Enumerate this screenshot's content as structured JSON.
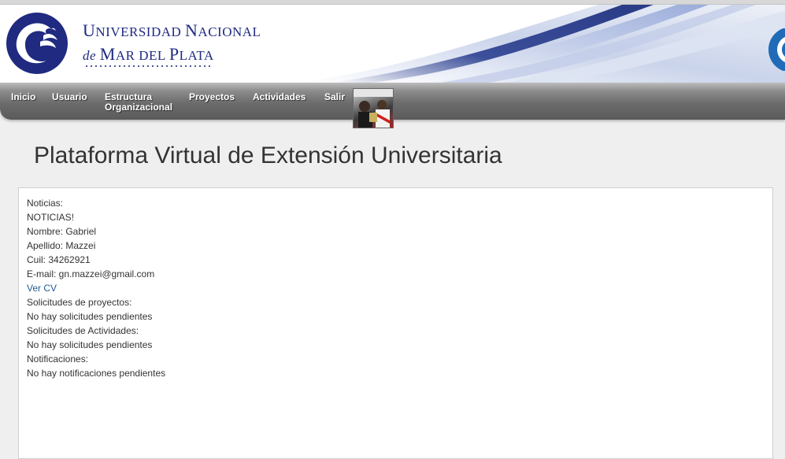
{
  "university": {
    "line1_initial": "U",
    "line1_rest": "NIVERSIDAD ",
    "line1b_initial": "N",
    "line1b_rest": "ACIONAL",
    "line2_prefix": "de",
    "line2_initial1": "M",
    "line2_rest1": "AR DEL ",
    "line2_initial2": "P",
    "line2_rest2": "LATA"
  },
  "nav": {
    "items": [
      {
        "label": "Inicio"
      },
      {
        "label": "Usuario"
      },
      {
        "label": "Estructura\nOrganizacional"
      },
      {
        "label": "Proyectos"
      },
      {
        "label": "Actividades"
      },
      {
        "label": "Salir"
      }
    ]
  },
  "page": {
    "title": "Plataforma Virtual de Extensión Universitaria"
  },
  "content": {
    "lines": [
      "Noticias:",
      "NOTICIAS!",
      "Nombre: Gabriel",
      "Apellido: Mazzei",
      "Cuil: 34262921",
      "E-mail: gn.mazzei@gmail.com",
      "Ver CV",
      "Solicitudes de proyectos:",
      "No hay solicitudes pendientes",
      "Solicitudes de Actividades:",
      "No hay solicitudes pendientes",
      "Notificaciones:",
      "No hay notificaciones pendientes"
    ]
  },
  "colors": {
    "brand_blue": "#1f2a80",
    "link_blue": "#1d5a95",
    "nav_gray": "#6c6c6c",
    "page_bg": "#efefef"
  },
  "icons": {
    "logo": "unmdp-wave-logo",
    "right_logo": "partial-logo-icon",
    "avatar": "user-photo"
  }
}
